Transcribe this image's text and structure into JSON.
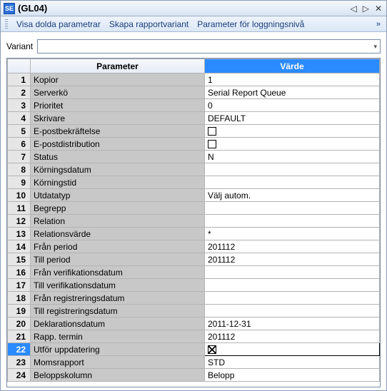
{
  "app_icon": "SE",
  "title": "(GL04)",
  "title_controls": {
    "prev": "◁",
    "next": "▷",
    "close": "✕"
  },
  "menu": {
    "items": [
      "Visa dolda parametrar",
      "Skapa rapportvariant",
      "Parameter för loggningsnivå"
    ],
    "expand": "»"
  },
  "variant": {
    "label": "Variant",
    "value": "",
    "arrow": "▾"
  },
  "columns": {
    "param": "Parameter",
    "value": "Värde"
  },
  "rows": [
    {
      "n": 1,
      "param": "Kopior",
      "value": "1"
    },
    {
      "n": 2,
      "param": "Serverkö",
      "value": "Serial Report Queue"
    },
    {
      "n": 3,
      "param": "Prioritet",
      "value": "0"
    },
    {
      "n": 4,
      "param": "Skrivare",
      "value": "DEFAULT"
    },
    {
      "n": 5,
      "param": "E-postbekräftelse",
      "value": "",
      "checkbox": true,
      "checked": false
    },
    {
      "n": 6,
      "param": "E-postdistribution",
      "value": "",
      "checkbox": true,
      "checked": false
    },
    {
      "n": 7,
      "param": "Status",
      "value": "N"
    },
    {
      "n": 8,
      "param": "Körningsdatum",
      "value": ""
    },
    {
      "n": 9,
      "param": "Körningstid",
      "value": ""
    },
    {
      "n": 10,
      "param": "Utdatatyp",
      "value": "Välj autom."
    },
    {
      "n": 11,
      "param": "Begrepp",
      "value": "",
      "sep": true
    },
    {
      "n": 12,
      "param": "Relation",
      "value": ""
    },
    {
      "n": 13,
      "param": "Relationsvärde",
      "value": "*"
    },
    {
      "n": 14,
      "param": "Från period",
      "value": "201112"
    },
    {
      "n": 15,
      "param": "Till period",
      "value": "201112"
    },
    {
      "n": 16,
      "param": "Från verifikationsdatum",
      "value": ""
    },
    {
      "n": 17,
      "param": "Till verifikationsdatum",
      "value": ""
    },
    {
      "n": 18,
      "param": "Från registreringsdatum",
      "value": ""
    },
    {
      "n": 19,
      "param": "Till registreringsdatum",
      "value": ""
    },
    {
      "n": 20,
      "param": "Deklarationsdatum",
      "value": "2011-12-31"
    },
    {
      "n": 21,
      "param": "Rapp. termin",
      "value": "201112"
    },
    {
      "n": 22,
      "param": "Utför uppdatering",
      "value": "",
      "checkbox": true,
      "checked": true,
      "selected": true
    },
    {
      "n": 23,
      "param": "Momsrapport",
      "value": "STD"
    },
    {
      "n": 24,
      "param": "Beloppskolumn",
      "value": "Belopp"
    }
  ]
}
